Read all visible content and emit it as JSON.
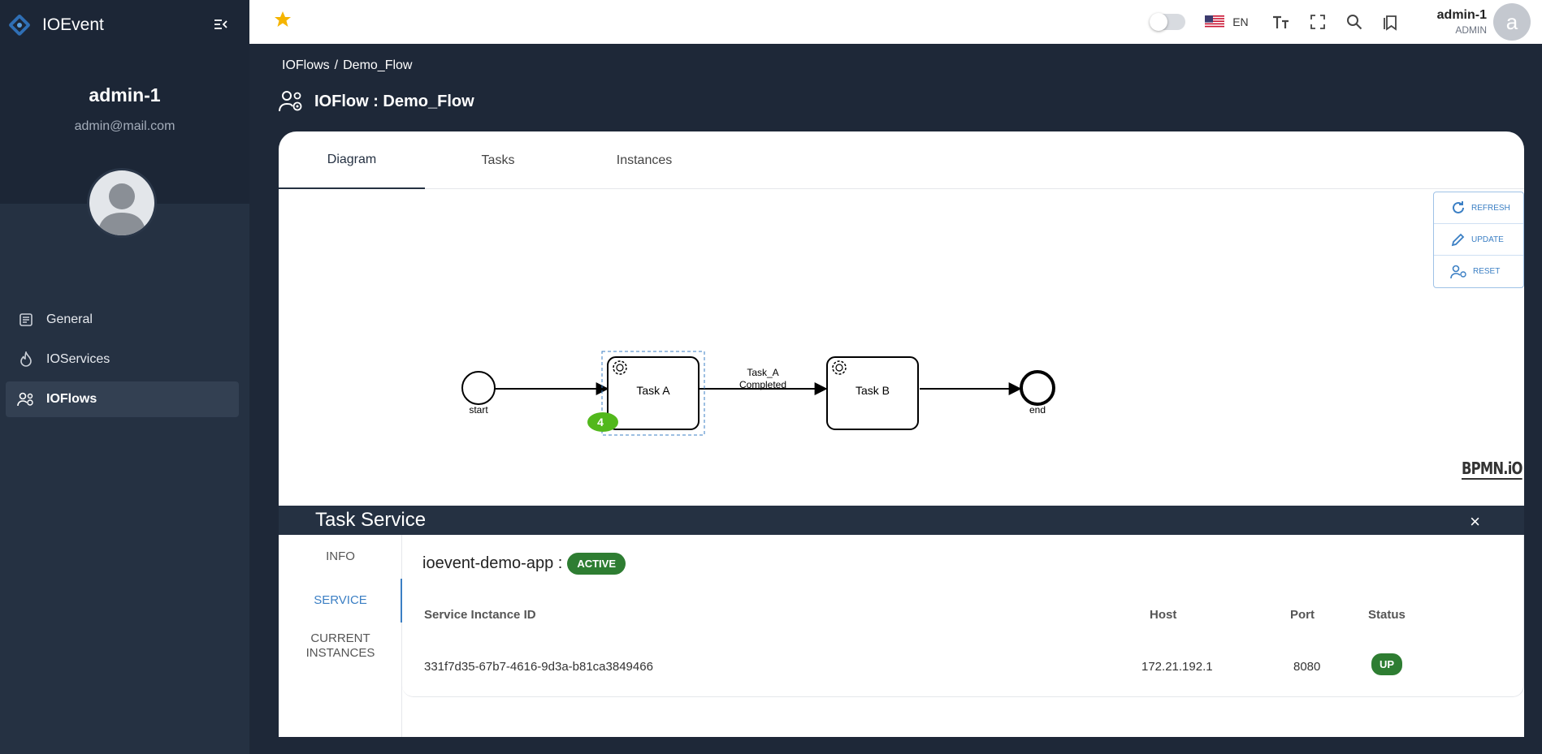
{
  "app": {
    "name": "IOEvent"
  },
  "profile": {
    "name": "admin-1",
    "email": "admin@mail.com"
  },
  "sidebar": {
    "items": [
      {
        "label": "General",
        "icon": "document-icon"
      },
      {
        "label": "IOServices",
        "icon": "fire-icon"
      },
      {
        "label": "IOFlows",
        "icon": "users-gear-icon",
        "active": true
      }
    ]
  },
  "topbar": {
    "language": "EN",
    "user_name": "admin-1",
    "user_role": "ADMIN",
    "avatar_letter": "a"
  },
  "breadcrumb": {
    "root": "IOFlows",
    "separator": "/",
    "current": "Demo_Flow"
  },
  "page": {
    "title": "IOFlow : Demo_Flow"
  },
  "tabs": [
    {
      "label": "Diagram",
      "active": true
    },
    {
      "label": "Tasks"
    },
    {
      "label": "Instances"
    }
  ],
  "diagram_actions": {
    "refresh": "REFRESH",
    "update": "UPDATE",
    "reset": "RESET"
  },
  "diagram": {
    "start_label": "start",
    "end_label": "end",
    "task_a": "Task A",
    "task_b": "Task B",
    "edge_label_line1": "Task_A",
    "edge_label_line2": "Completed",
    "task_a_count": "4",
    "watermark": "BPMN.iO"
  },
  "task_service": {
    "title": "Task Service",
    "close": "×",
    "nav": {
      "info": "INFO",
      "service": "SERVICE",
      "current_line1": "CURRENT",
      "current_line2": "INSTANCES"
    },
    "app_name": "ioevent-demo-app :",
    "app_status": "ACTIVE",
    "columns": {
      "id": "Service Inctance ID",
      "host": "Host",
      "port": "Port",
      "status": "Status"
    },
    "row": {
      "id": "331f7d35-67b7-4616-9d3a-b81ca3849466",
      "host": "172.21.192.1",
      "port": "8080",
      "status": "UP"
    }
  },
  "colors": {
    "sidebar": "#253142",
    "accent": "#3b7fc4",
    "success": "#2e7d32",
    "star": "#f5b400",
    "token": "#52b81c"
  }
}
